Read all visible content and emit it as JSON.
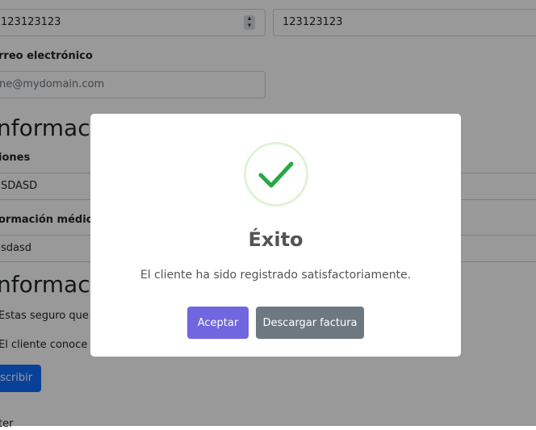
{
  "form": {
    "phone_value_1": "123123123",
    "phone_value_2": "123123123",
    "email_label": "rreo electrónico",
    "email_placeholder": "ne@mydomain.com",
    "section_heading_1": "nformació",
    "observaciones_label": "iones",
    "observaciones_value": "SDASD",
    "medical_label": "ormación médica r",
    "medical_value": "sdasd",
    "section_heading_2": "nformació",
    "check_text_1": "Estas seguro que la",
    "check_text_2": "El cliente conoce qu",
    "subscribe_button": "scribir",
    "footer_text": "ter"
  },
  "modal": {
    "icon": "success-check-icon",
    "title": "Éxito",
    "message": "El cliente ha sido registrado satisfactoriamente.",
    "confirm_button": "Aceptar",
    "download_button": "Descargar factura"
  },
  "colors": {
    "confirm": "#7066e0",
    "download": "#6e7881",
    "success": "#27a844",
    "overlay": "rgba(0,0,0,0.4)"
  }
}
